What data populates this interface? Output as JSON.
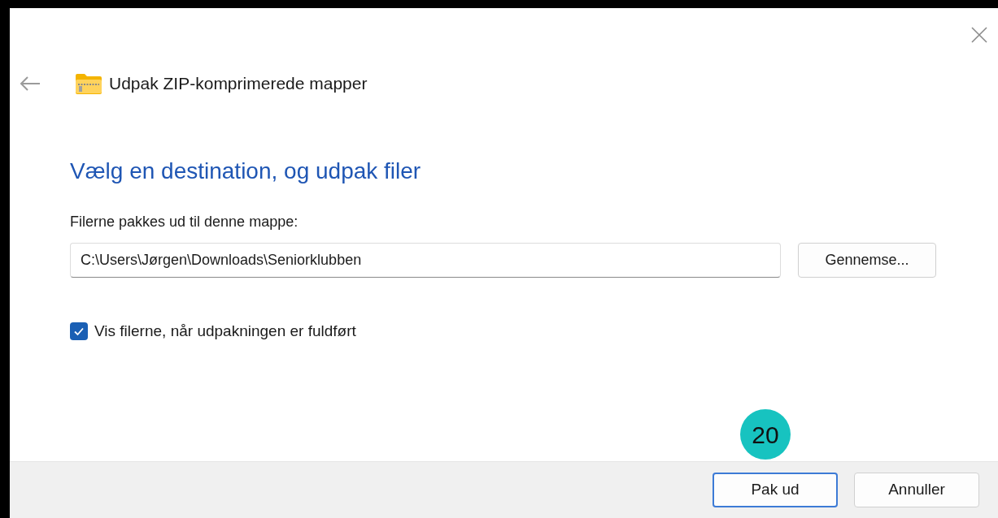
{
  "window": {
    "title": "Udpak ZIP-komprimerede mapper"
  },
  "heading": "Vælg en destination, og udpak filer",
  "destination": {
    "label": "Filerne pakkes ud til denne mappe:",
    "value": "C:\\Users\\Jørgen\\Downloads\\Seniorklubben",
    "browse_button": "Gennemse..."
  },
  "show_files": {
    "label": "Vis filerne, når udpakningen er fuldført",
    "checked": true
  },
  "step_badge": "20",
  "buttons": [
    {
      "label": "Pak ud",
      "selected": true
    },
    {
      "label": "Annuller",
      "selected": false
    }
  ]
}
